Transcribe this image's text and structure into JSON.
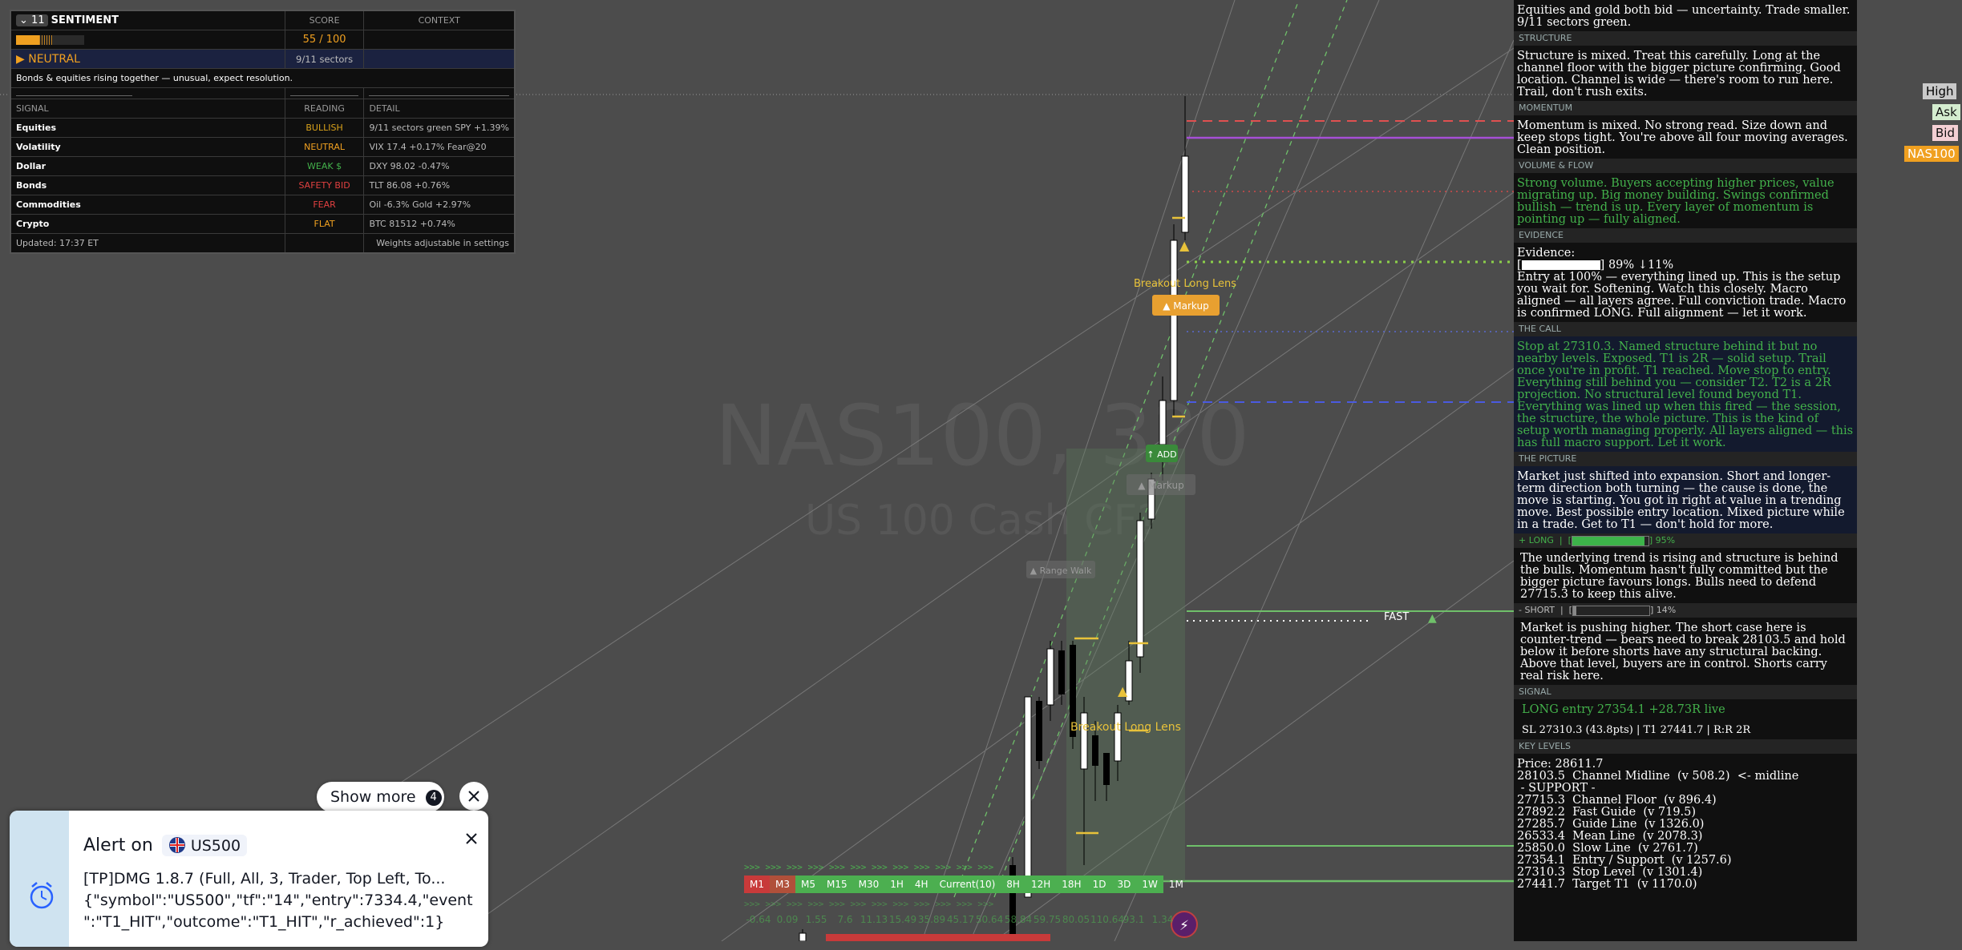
{
  "watermark": {
    "symbol": "NAS100, 3?0",
    "name": "US 100 Cash CF?"
  },
  "sentiment": {
    "badge": "11",
    "title": "SENTIMENT",
    "col_score": "SCORE",
    "col_context": "CONTEXT",
    "score_value": "55 / 100",
    "score_fraction": 0.55,
    "state": "▶ NEUTRAL",
    "sectors": "9/11 sectors",
    "note": "Bonds & equities rising together — unusual, expect resolution.",
    "head_signal": "SIGNAL",
    "head_reading": "READING",
    "head_detail": "DETAIL",
    "rows": [
      {
        "signal": "Equities",
        "reading": "BULLISH",
        "color": "#d9a21b",
        "detail": "9/11 sectors green  SPY +1.39%"
      },
      {
        "signal": "Volatility",
        "reading": "NEUTRAL",
        "color": "#f0a020",
        "detail": "VIX 17.4  +0.17%  Fear@20"
      },
      {
        "signal": "Dollar",
        "reading": "WEAK $",
        "color": "#43b14b",
        "detail": "DXY 98.02  -0.47%"
      },
      {
        "signal": "Bonds",
        "reading": "SAFETY BID",
        "color": "#e04040",
        "detail": "TLT 86.08  +0.76%"
      },
      {
        "signal": "Commodities",
        "reading": "FEAR",
        "color": "#e04040",
        "detail": "Oil -6.3%  Gold +2.97%"
      },
      {
        "signal": "Crypto",
        "reading": "FLAT",
        "color": "#f0a020",
        "detail": "BTC 81512  +0.74%"
      }
    ],
    "updated": "Updated: 17:37 ET",
    "weights": "Weights adjustable in settings"
  },
  "panel": {
    "intro": "Equities and gold both bid — uncertainty. Trade smaller. 9/11 sectors green.",
    "structure_h": "STRUCTURE",
    "structure": "Structure is mixed. Treat this carefully. Long at the channel floor with the bigger picture confirming. Good location. Channel is wide — there's room to run here. Trail, don't rush exits.",
    "momentum_h": "MOMENTUM",
    "momentum": "Momentum is mixed. No strong read. Size down and keep stops tight. You're above all four moving averages. Clean position.",
    "volume_h": "VOLUME & FLOW",
    "volume": "Strong volume. Buyers accepting higher prices, value migrating up. Big money building. Swings confirmed bullish — trend is up. Every layer of momentum is pointing up — fully aligned.",
    "evidence_h": "EVIDENCE",
    "evidence_label": "Evidence:",
    "evidence_bar": "89%  ↓11%",
    "evidence_text": "Entry at 100% — everything lined up. This is the setup you wait for.  Softening. Watch this closely. Macro aligned — all layers agree. Full conviction trade. Macro is confirmed LONG. Full alignment — let it work.",
    "call_h": "THE CALL",
    "call": "Stop at 27310.3. Named structure behind it but no nearby levels. Exposed. T1 is 2R — solid setup. Trail once you're in profit. T1 reached. Move stop to entry. Everything still behind you — consider T2. T2 is a 2R projection. No structural level found beyond T1. Everything was lined up when this fired — the session, the structure, the whole picture. This is the kind of setup worth managing properly. All layers aligned — this has full macro support. Let it work.",
    "picture_h": "THE PICTURE",
    "picture": "Market just shifted into expansion. Short and longer-term direction both turning — the cause is done, the move is starting. You got in right at value in a trending move. Best possible entry location. Mixed picture while in a trade. Get to T1 — don't hold for more.",
    "long_h": "+ LONG",
    "long_pct": "95%",
    "long_fraction": 0.95,
    "long_text": "The underlying trend is rising and structure is behind the bulls. Momentum hasn't fully committed but the bigger picture favours longs. Bulls need to defend 27715.3 to keep this alive.",
    "short_h": "- SHORT",
    "short_pct": "14%",
    "short_fraction": 0.14,
    "short_text": "Market is pushing higher. The short case here is counter-trend — bears need to break 28103.5 and hold below it before shorts have any structural backing. Above that level, buyers are in control. Shorts carry real risk here.",
    "signal_h": "SIGNAL",
    "signal_line1": "LONG  entry 27354.1  +28.73R live",
    "signal_line2": "SL 27310.3  (43.8pts)  |  T1 27441.7  |  R:R 2R",
    "levels_h": "KEY LEVELS",
    "levels": [
      "Price: 28611.7",
      "28103.5  Channel Midline  (v 508.2)  <- midline",
      " - SUPPORT - ",
      "27715.3  Channel Floor  (v 896.4)",
      "27892.2  Fast Guide  (v 719.5)",
      "27285.7  Guide Line  (v 1326.0)",
      "26533.4  Mean Line  (v 2078.3)",
      "25850.0  Slow Line  (v 2761.7)",
      "27354.1  Entry / Support  (v 1257.6)",
      "27310.3  Stop Level  (v 1301.4)",
      "27441.7  Target T1  (v 1170.0)"
    ]
  },
  "edge_labels": {
    "high": "High",
    "ask": "Ask",
    "bid": "Bid",
    "symbol": "NAS100"
  },
  "chart_labels": {
    "breakout1": "Breakout Long Lens",
    "markup": "▲ Markup",
    "add": "↑ ADD",
    "markup2": "▲ Markup",
    "range": "▲ Range Walk",
    "breakout2": "Breakout Long Lens",
    "fast": "FAST"
  },
  "timeframes": [
    {
      "label": "M1",
      "color": "#c83a3a"
    },
    {
      "label": "M3",
      "color": "#b0503a"
    },
    {
      "label": "M5",
      "color": "#4caf50"
    },
    {
      "label": "M15",
      "color": "#4caf50"
    },
    {
      "label": "M30",
      "color": "#4caf50"
    },
    {
      "label": "1H",
      "color": "#4caf50"
    },
    {
      "label": "4H",
      "color": "#4caf50"
    },
    {
      "label": "Current(10)",
      "color": "#4caf50"
    },
    {
      "label": "8H",
      "color": "#4caf50"
    },
    {
      "label": "12H",
      "color": "#4caf50"
    },
    {
      "label": "18H",
      "color": "#4caf50"
    },
    {
      "label": "1D",
      "color": "#4caf50"
    },
    {
      "label": "3D",
      "color": "#4caf50"
    },
    {
      "label": "1W",
      "color": "#4caf50"
    },
    {
      "label": "1M",
      "color": "transparent"
    }
  ],
  "tf_values": [
    "-0.64",
    "0.09",
    "1.55",
    "7.6",
    "11.13",
    "15.49",
    "35.89",
    "45.17",
    "50.64",
    "58.84",
    "59.75",
    "80.05",
    "110.64",
    "93.1",
    "1.34"
  ],
  "alert": {
    "show_more": "Show more",
    "more_count": "4",
    "title": "Alert on",
    "symbol": "US500",
    "line1": "[TP]DMG 1.8.7 (Full, All, 3, Trader, Top Left, To...",
    "line2": "{\"symbol\":\"US500\",\"tf\":\"14\",\"entry\":7334.4,\"event",
    "line3": "\":\"T1_HIT\",\"outcome\":\"T1_HIT\",\"r_achieved\":1}"
  }
}
